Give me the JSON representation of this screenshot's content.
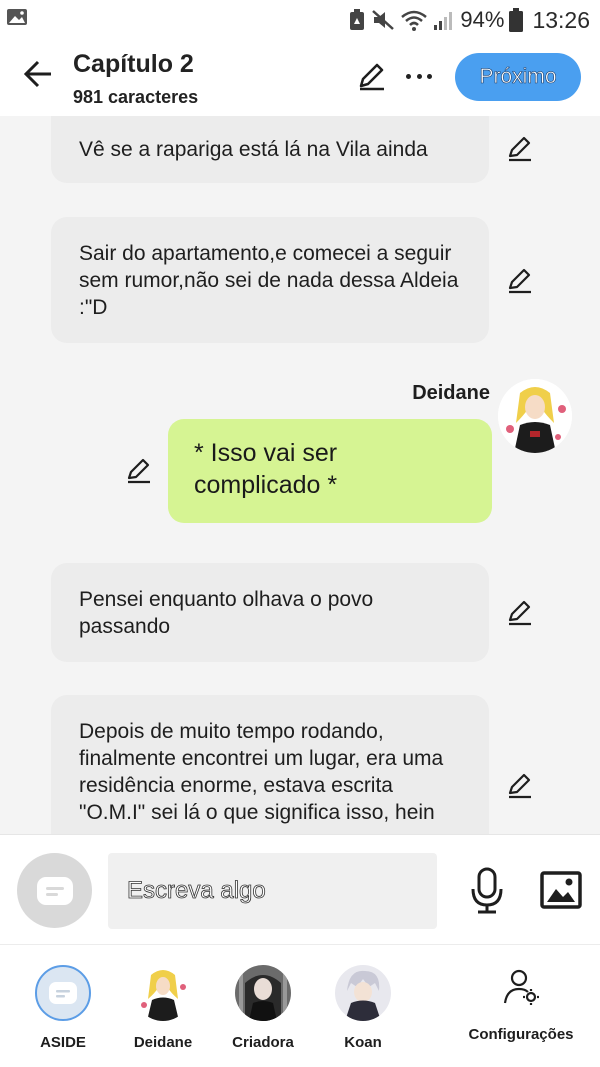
{
  "status_bar": {
    "battery": "94%",
    "time": "13:26",
    "icons": [
      "gallery-icon",
      "recycle-icon",
      "mute-icon",
      "wifi-icon",
      "signal-icon",
      "battery-icon"
    ]
  },
  "header": {
    "title": "Capítulo 2",
    "subtitle": "981 caracteres",
    "next_label": "Próximo"
  },
  "messages": [
    {
      "type": "narration",
      "text": "Vê se a rapariga está lá na Vila ainda"
    },
    {
      "type": "narration",
      "text": "Sair do apartamento,e comecei a seguir sem rumor,não sei de nada dessa Aldeia :\"D"
    },
    {
      "type": "dialogue",
      "speaker": "Deidane",
      "text": "* Isso vai ser complicado *"
    },
    {
      "type": "narration",
      "text": "Pensei enquanto olhava o povo passando"
    },
    {
      "type": "narration",
      "text": "Depois de muito tempo rodando, finalmente encontrei um lugar, era uma residência enorme, estava escrita \"O.M.I\" sei lá o que significa isso, hein"
    }
  ],
  "input": {
    "placeholder": "Escreva algo"
  },
  "characters": [
    {
      "name": "ASIDE"
    },
    {
      "name": "Deidane"
    },
    {
      "name": "Criadora"
    },
    {
      "name": "Koan"
    }
  ],
  "settings_label": "Configurações",
  "colors": {
    "accent": "#4a9ff0",
    "dialogue_bubble": "#d6f493",
    "narration_bubble": "#ececec",
    "chat_background": "#f4f4f4"
  }
}
